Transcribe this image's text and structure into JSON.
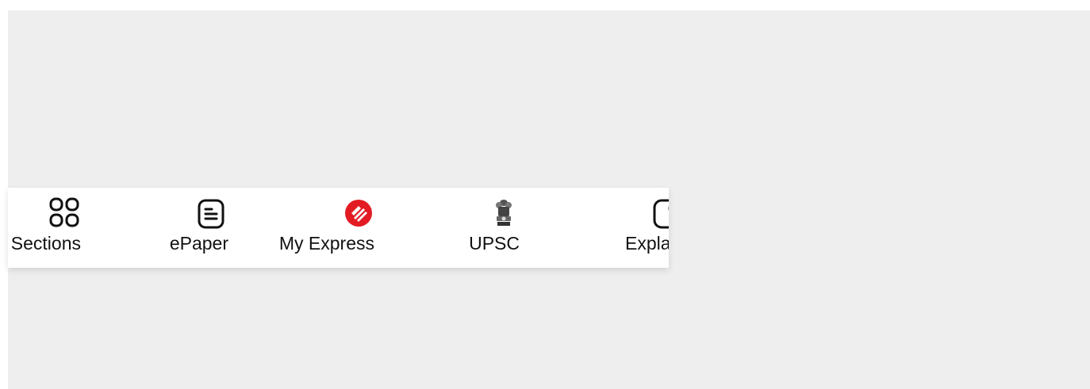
{
  "bottom_nav": {
    "items": [
      {
        "label": "Sections",
        "icon": "grid-icon"
      },
      {
        "label": "ePaper",
        "icon": "epaper-icon"
      },
      {
        "label": "My Express",
        "icon": "indian-express-logo-icon"
      },
      {
        "label": "UPSC",
        "icon": "national-emblem-icon"
      },
      {
        "label": "Explained",
        "icon": "explained-icon"
      }
    ],
    "visible_truncated_label": "Expla"
  },
  "colors": {
    "background": "#eeeeee",
    "nav_background": "#ffffff",
    "brand_red": "#e31b23",
    "text": "#111111"
  }
}
